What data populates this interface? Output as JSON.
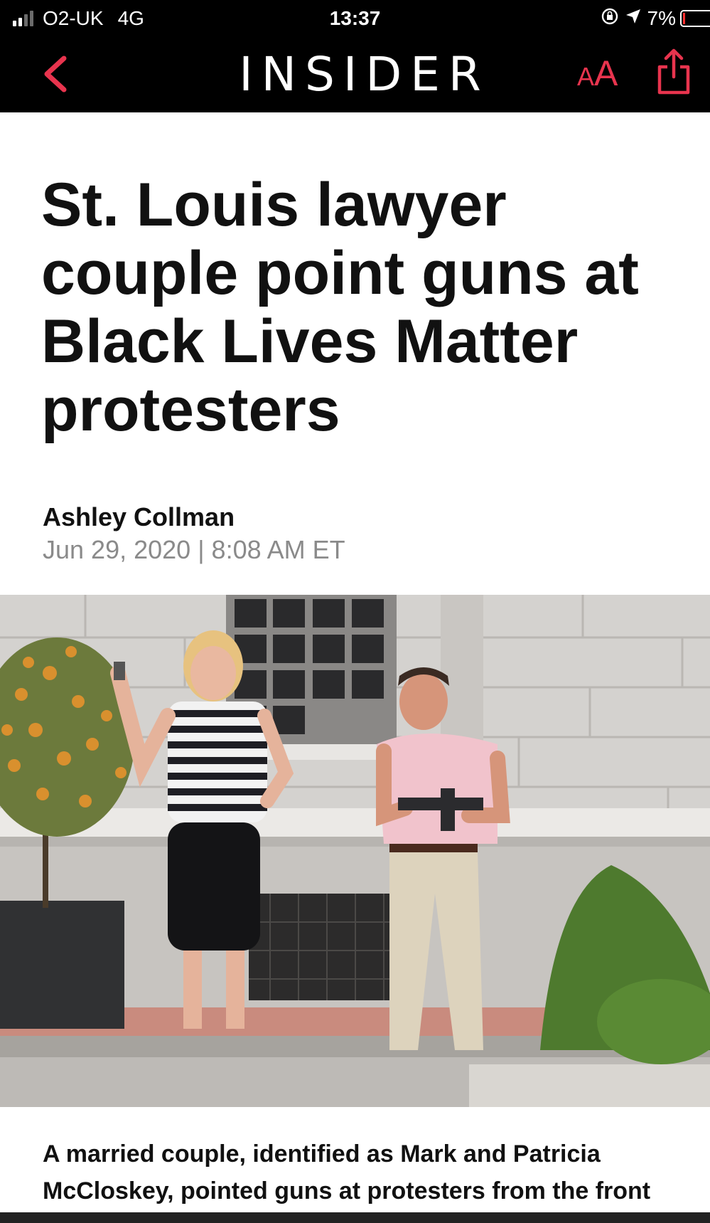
{
  "status_bar": {
    "carrier": "O2-UK",
    "network": "4G",
    "time": "13:37",
    "battery": "7%"
  },
  "nav": {
    "brand": "INSIDER",
    "text_size_small": "A",
    "text_size_big": "A",
    "accent_color": "#e8344e"
  },
  "article": {
    "headline": "St. Louis lawyer couple point guns at Black Lives Matter protesters",
    "author": "Ashley Collman",
    "date": "Jun 29, 2020",
    "time": "8:08 AM ET",
    "lede": "A married couple, identified as Mark and Patricia McCloskey, pointed guns at protesters from the front"
  },
  "icons": [
    "back-chevron-icon",
    "text-size-icon",
    "share-icon",
    "location-arrow-icon",
    "rotation-lock-icon",
    "battery-icon",
    "signal-icon"
  ]
}
